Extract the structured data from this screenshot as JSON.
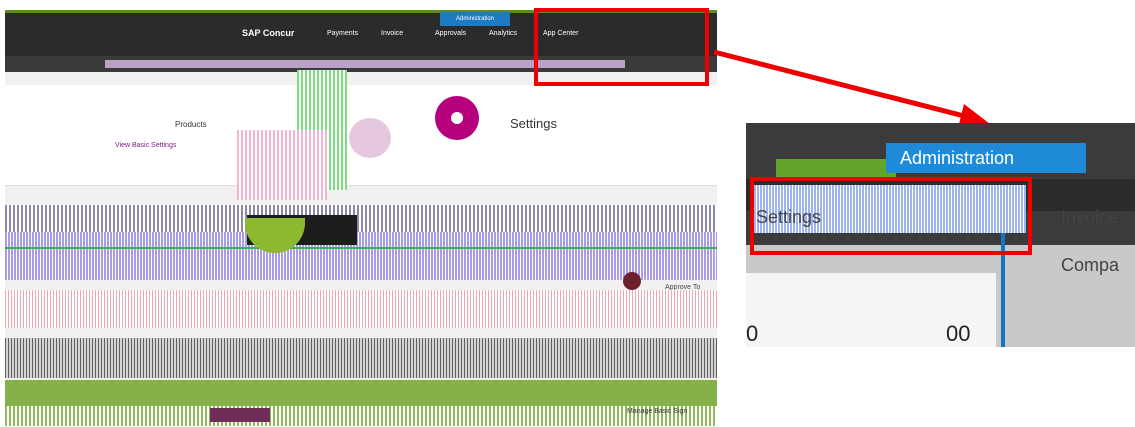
{
  "main_screenshot": {
    "brand": "SAP Concur",
    "top_nav": [
      "Payments",
      "Invoice",
      "Approvals",
      "Analytics",
      "App Center"
    ],
    "admin_tab": "Administration",
    "card": {
      "products_label": "Products",
      "settings_label": "Settings",
      "basic_settings_link": "View Basic Settings"
    },
    "approve_text": "Approve To",
    "manage_text": "Manage Basic Sign"
  },
  "zoom_panel": {
    "admin_tab": "Administration",
    "settings_label": "Settings",
    "invoice_label": "Invoice",
    "company_label": "Compa",
    "values": [
      "0",
      "00"
    ]
  },
  "colors": {
    "highlight": "#ee0000",
    "admin_blue": "#1f8ad8",
    "brand_magenta": "#b7007c",
    "nav_dark": "#2b2b2b"
  }
}
